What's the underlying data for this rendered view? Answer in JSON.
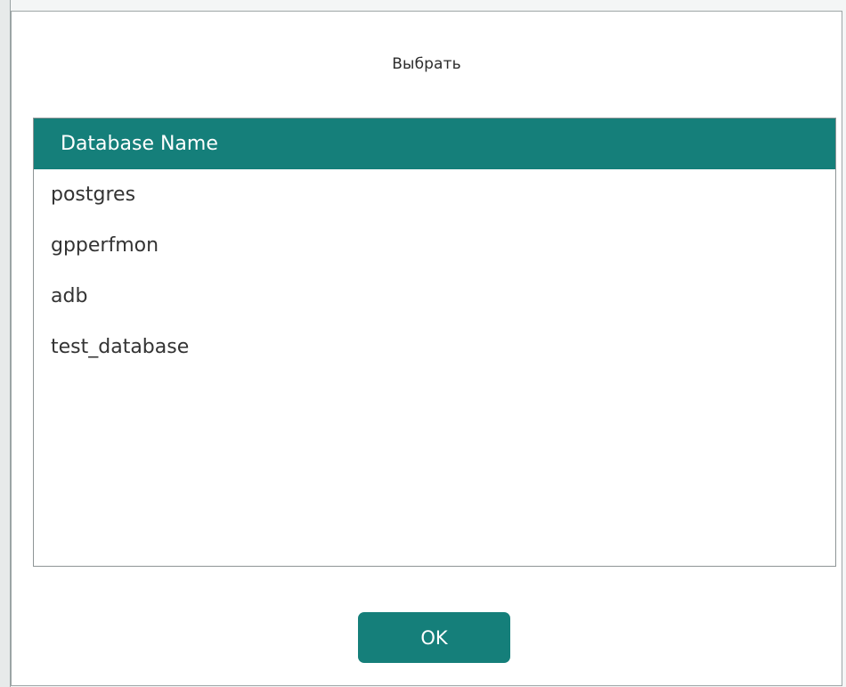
{
  "dialog": {
    "title": "Выбрать"
  },
  "table": {
    "header": "Database Name",
    "rows": [
      "postgres",
      "gpperfmon",
      "adb",
      "test_database"
    ]
  },
  "buttons": {
    "ok_label": "OK"
  },
  "colors": {
    "accent": "#157f7a",
    "background": "#ffffff",
    "text": "#333333"
  }
}
